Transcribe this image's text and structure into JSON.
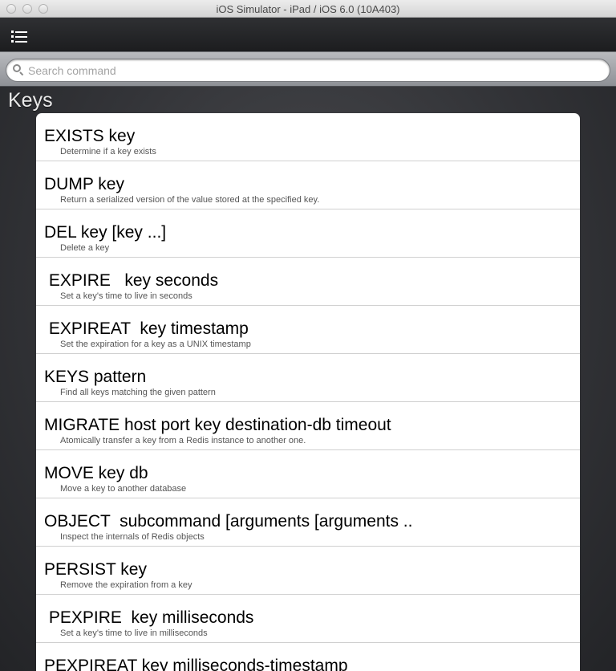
{
  "window": {
    "title": "iOS Simulator - iPad / iOS 6.0 (10A403)"
  },
  "navbar": {
    "menu_icon": "list-menu-icon"
  },
  "search": {
    "placeholder": "Search command",
    "value": "",
    "icon": "search-icon"
  },
  "section": {
    "title": "Keys"
  },
  "commands": [
    {
      "command": "EXISTS key",
      "description": "Determine if a key exists"
    },
    {
      "command": "DUMP key",
      "description": "Return a serialized version of the value stored at the specified key."
    },
    {
      "command": "DEL key [key ...]",
      "description": "Delete a key"
    },
    {
      "command": " EXPIRE   key seconds",
      "description": "Set a key's time to live in seconds"
    },
    {
      "command": " EXPIREAT  key timestamp",
      "description": "Set the expiration for a key as a UNIX timestamp"
    },
    {
      "command": "KEYS pattern",
      "description": "Find all keys matching the given pattern"
    },
    {
      "command": "MIGRATE host port key destination-db timeout",
      "description": "Atomically transfer a key from a Redis instance to another one."
    },
    {
      "command": "MOVE key db",
      "description": "Move a key to another database"
    },
    {
      "command": "OBJECT  subcommand [arguments [arguments ..",
      "description": "Inspect the internals of Redis objects"
    },
    {
      "command": "PERSIST key",
      "description": "Remove the expiration from a key"
    },
    {
      "command": " PEXPIRE  key milliseconds",
      "description": "Set a key's time to live in milliseconds"
    },
    {
      "command": "PEXPIREAT key milliseconds-timestamp",
      "description": ""
    }
  ]
}
